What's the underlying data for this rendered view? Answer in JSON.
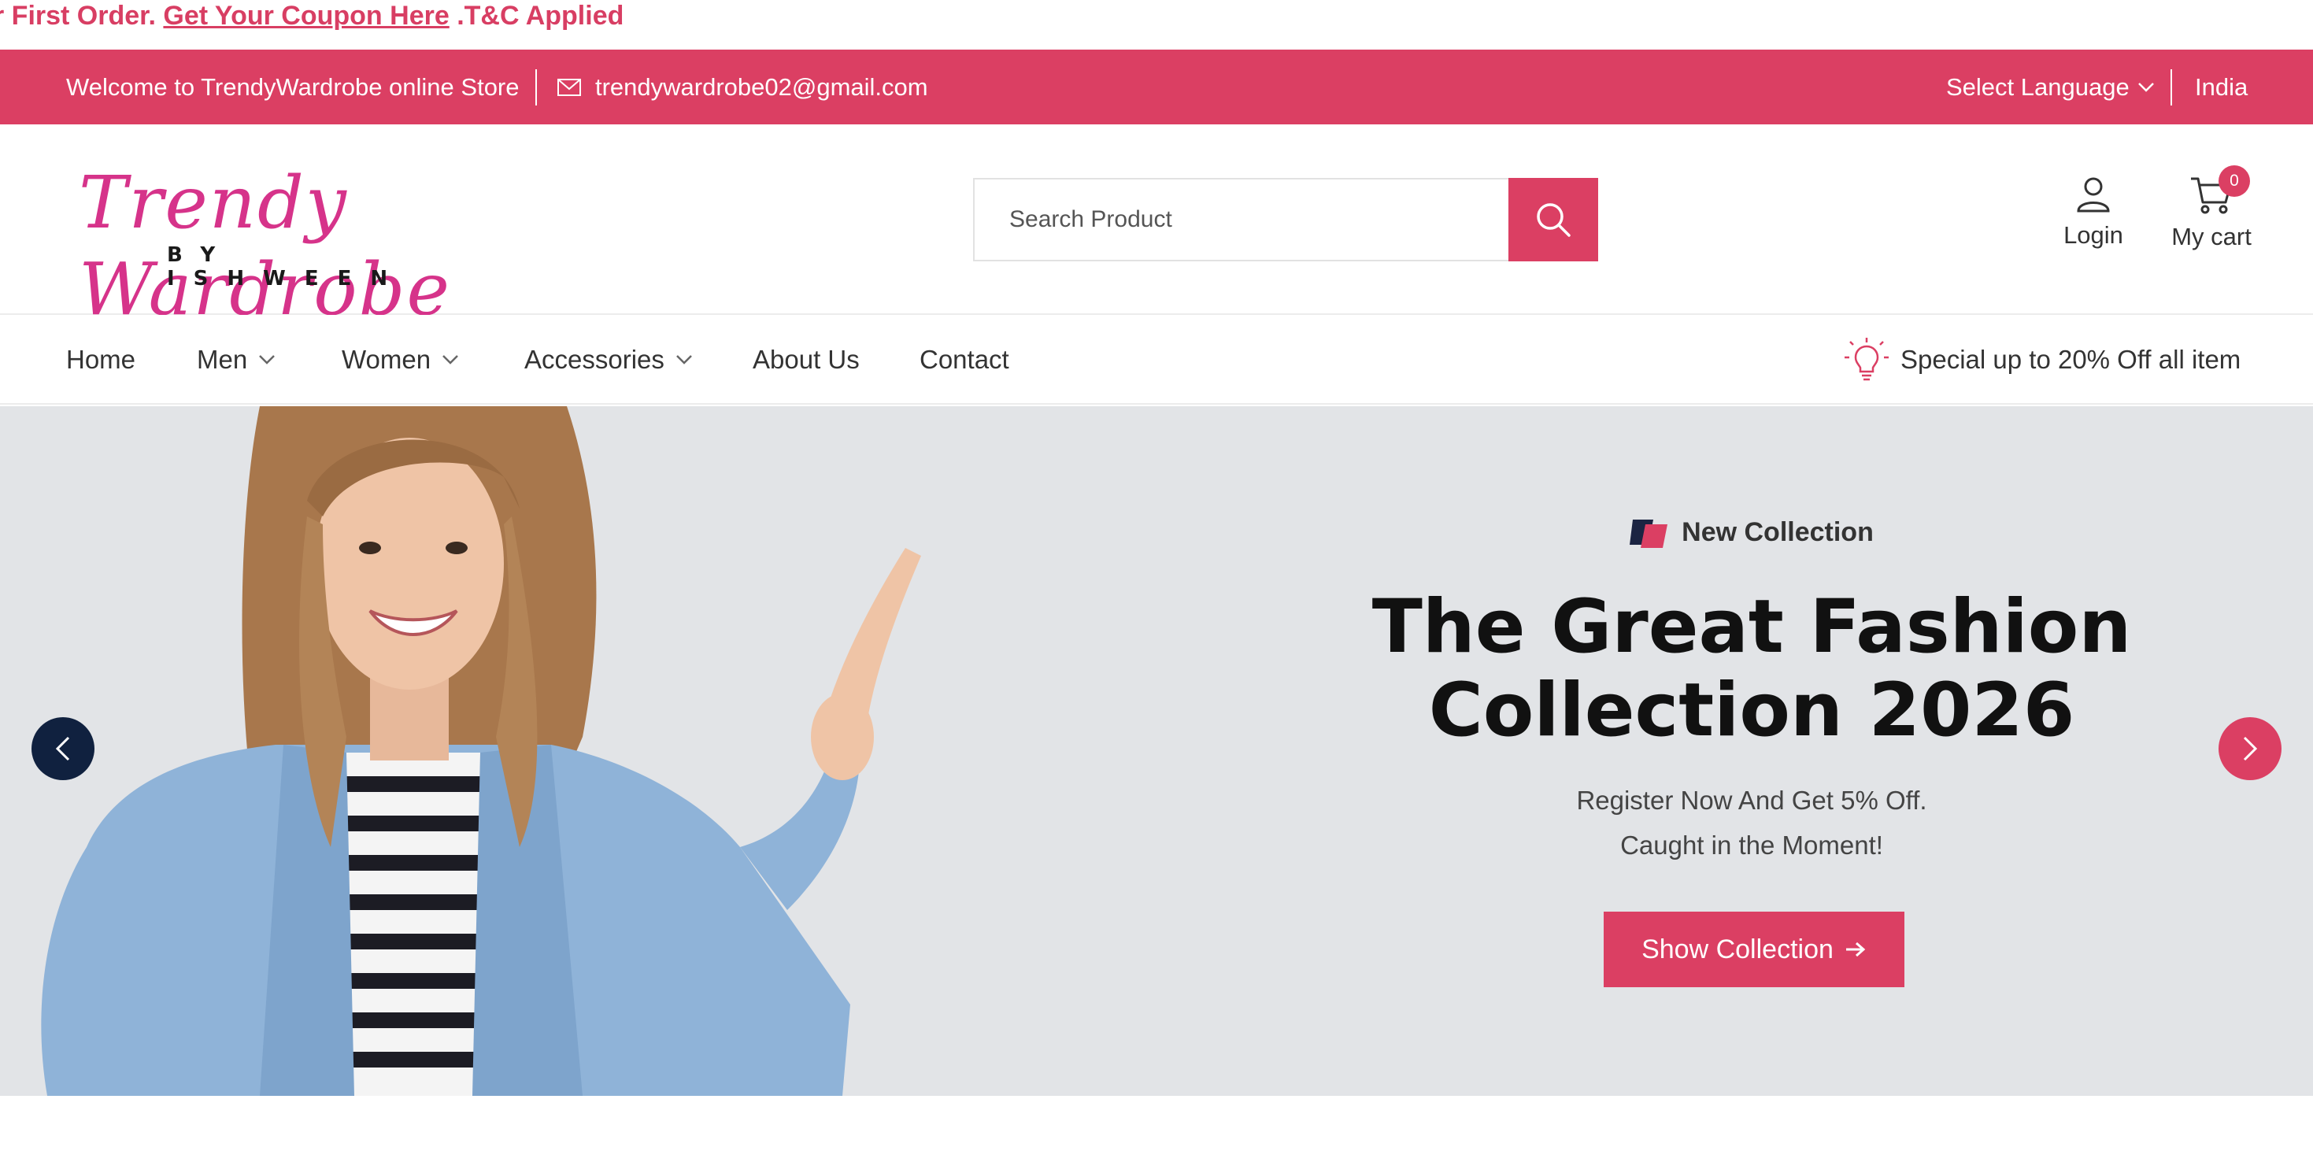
{
  "promo": {
    "prefix": "r First Order.",
    "link": "Get Your Coupon Here",
    "suffix": ".T&C Applied"
  },
  "topbar": {
    "welcome": "Welcome to TrendyWardrobe online Store",
    "email": "trendywardrobe02@gmail.com",
    "language": "Select Language",
    "country": "India"
  },
  "header": {
    "logo_script": "Trendy Wardrobe",
    "logo_sub": "BY ISHWEEN",
    "search_placeholder": "Search Product",
    "login_label": "Login",
    "cart_label": "My cart",
    "cart_count": "0"
  },
  "nav": {
    "items": [
      {
        "label": "Home",
        "dropdown": false
      },
      {
        "label": "Men",
        "dropdown": true
      },
      {
        "label": "Women",
        "dropdown": true
      },
      {
        "label": "Accessories",
        "dropdown": true
      },
      {
        "label": "About Us",
        "dropdown": false
      },
      {
        "label": "Contact",
        "dropdown": false
      }
    ],
    "special": "Special up to 20% Off all item"
  },
  "hero": {
    "tag": "New Collection",
    "title_line1": "The Great Fashion",
    "title_line2": "Collection 2026",
    "sub_line1": "Register Now And Get 5% Off.",
    "sub_line2": "Caught in the Moment!",
    "cta": "Show Collection"
  },
  "colors": {
    "accent": "#db3f63",
    "dark_nav": "#10213f",
    "hero_bg": "#e2e4e7"
  }
}
